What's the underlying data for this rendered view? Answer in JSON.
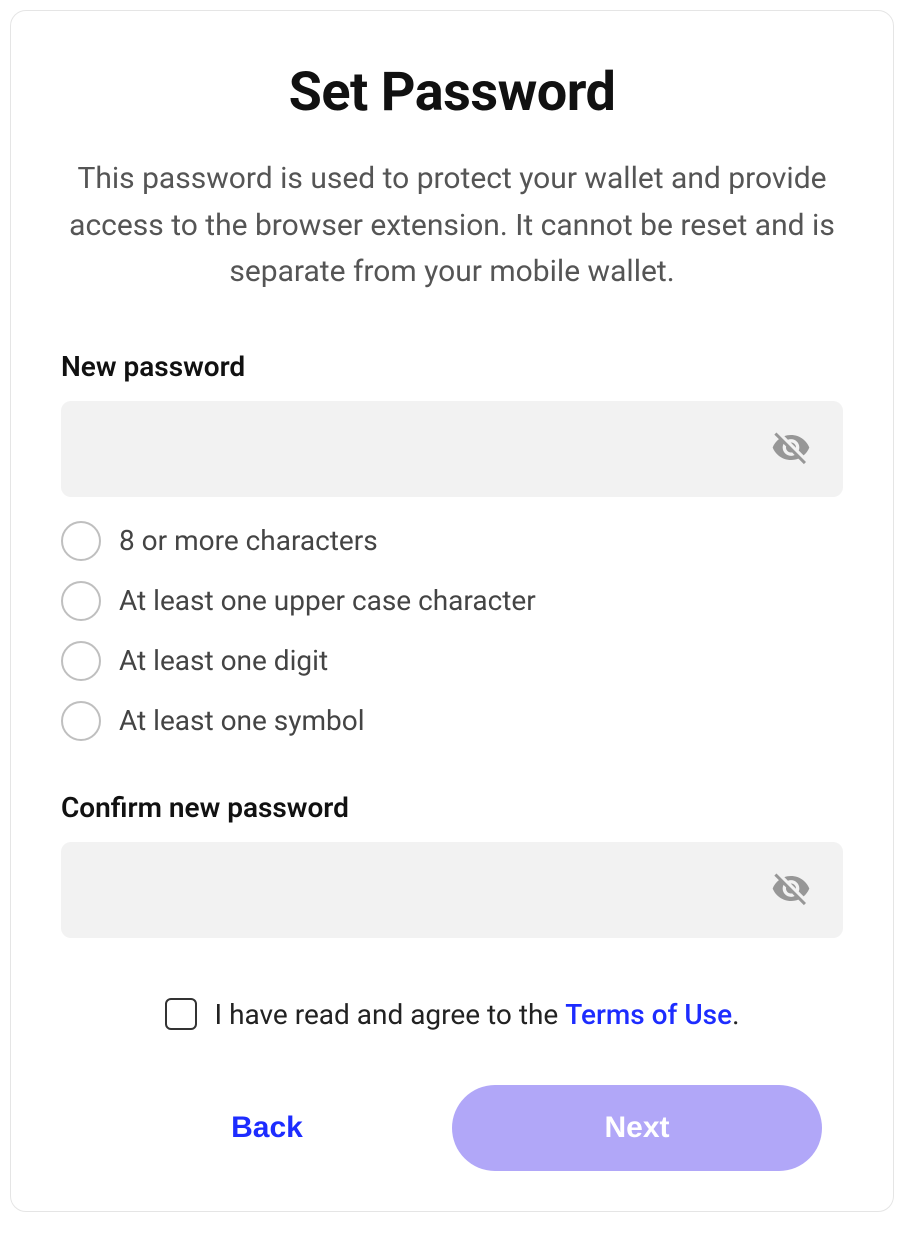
{
  "title": "Set Password",
  "description": "This password is used to protect your wallet and provide access to the browser extension. It cannot be reset and is separate from your mobile wallet.",
  "newPassword": {
    "label": "New password",
    "value": ""
  },
  "confirmPassword": {
    "label": "Confirm new password",
    "value": ""
  },
  "requirements": [
    {
      "text": "8 or more characters",
      "met": false
    },
    {
      "text": "At least one upper case character",
      "met": false
    },
    {
      "text": "At least one digit",
      "met": false
    },
    {
      "text": "At least one symbol",
      "met": false
    }
  ],
  "terms": {
    "prefix": "I have read and agree to the ",
    "linkText": "Terms of Use",
    "suffix": ".",
    "checked": false
  },
  "buttons": {
    "back": "Back",
    "next": "Next"
  }
}
